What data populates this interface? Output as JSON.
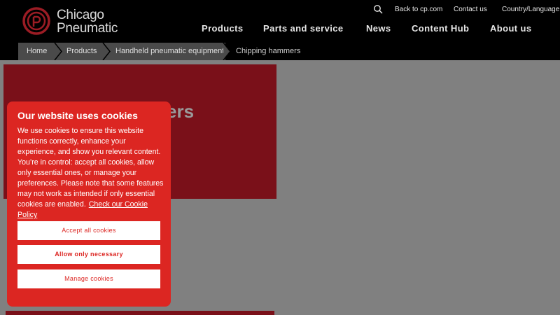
{
  "header": {
    "logo_line1": "Chicago",
    "logo_line2": "Pneumatic",
    "logo_monogram": "CP",
    "utility": {
      "search_icon": "search-icon",
      "back": "Back to cp.com",
      "contact": "Contact us",
      "country": "Country/Language"
    },
    "nav": {
      "products": "Products",
      "parts": "Parts and service",
      "news": "News",
      "content_hub": "Content Hub",
      "about": "About us"
    }
  },
  "breadcrumb": [
    {
      "label": "Home"
    },
    {
      "label": "Products"
    },
    {
      "label": "Handheld pneumatic equipment"
    },
    {
      "label": "Chipping hammers"
    }
  ],
  "hero": {
    "title_visible": "ers"
  },
  "cookie": {
    "title": "Our website uses cookies",
    "body": "We use cookies to ensure this website functions correctly, enhance your experience, and show you relevant content. You’re in control: accept all cookies, allow only essential ones, or manage your preferences. Please note that some features may not work as intended if only essential cookies are enabled.",
    "policy_link": "Check our Cookie Policy",
    "accept": "Accept all cookies",
    "necessary": "Allow only necessary",
    "manage": "Manage cookies"
  },
  "colors": {
    "brand_red": "#dc2622",
    "hero_red": "#7a1019",
    "header_bg": "#000000",
    "overlay_gray": "#808080"
  }
}
